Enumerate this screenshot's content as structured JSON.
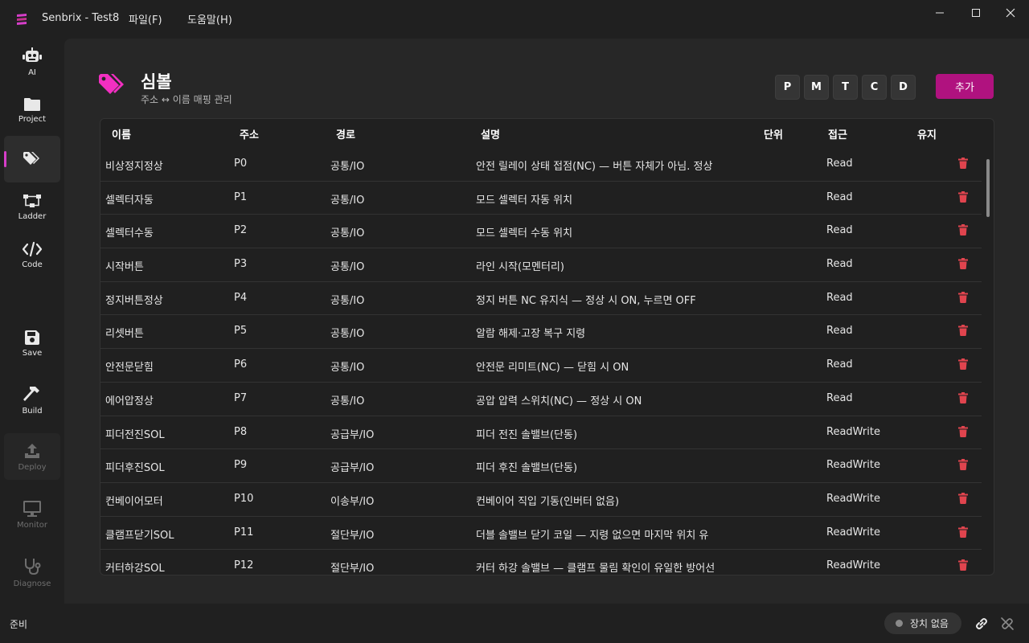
{
  "window": {
    "title": "Senbrix - Test8",
    "menu": [
      "파일(F)",
      "도움말(H)"
    ]
  },
  "nav": [
    {
      "label": "AI",
      "icon": "robot-icon"
    },
    {
      "label": "Project",
      "icon": "folder-icon"
    },
    {
      "label": "",
      "icon": "tags-icon",
      "active": true
    },
    {
      "label": "Ladder",
      "icon": "ladder-icon"
    },
    {
      "label": "Code",
      "icon": "code-icon"
    },
    {
      "label": "Save",
      "icon": "save-icon"
    },
    {
      "label": "Build",
      "icon": "hammer-icon"
    },
    {
      "label": "Deploy",
      "icon": "upload-icon",
      "disabled": true
    },
    {
      "label": "Monitor",
      "icon": "monitor-icon",
      "disabled": true
    },
    {
      "label": "Diagnose",
      "icon": "stethoscope-icon",
      "disabled": true
    }
  ],
  "page": {
    "title": "심볼",
    "subtitle": "주소 ↔ 이름 매핑 관리",
    "filters": [
      "P",
      "M",
      "T",
      "C",
      "D"
    ],
    "add_label": "추가"
  },
  "table": {
    "columns": {
      "name": "이름",
      "addr": "주소",
      "path": "경로",
      "desc": "설명",
      "unit": "단위",
      "access": "접근",
      "retain": "유지"
    },
    "rows": [
      {
        "name": "비상정지정상",
        "addr": "P0",
        "path": "공통/IO",
        "desc": "안전 릴레이 상태 접점(NC) — 버튼 자체가 아님. 정상",
        "access": "Read"
      },
      {
        "name": "셀렉터자동",
        "addr": "P1",
        "path": "공통/IO",
        "desc": "모드 셀렉터 자동 위치",
        "access": "Read"
      },
      {
        "name": "셀렉터수동",
        "addr": "P2",
        "path": "공통/IO",
        "desc": "모드 셀렉터 수동 위치",
        "access": "Read"
      },
      {
        "name": "시작버튼",
        "addr": "P3",
        "path": "공통/IO",
        "desc": "라인 시작(모멘터리)",
        "access": "Read"
      },
      {
        "name": "정지버튼정상",
        "addr": "P4",
        "path": "공통/IO",
        "desc": "정지 버튼 NC 유지식 — 정상 시 ON, 누르면 OFF",
        "access": "Read"
      },
      {
        "name": "리셋버튼",
        "addr": "P5",
        "path": "공통/IO",
        "desc": "알람 해제·고장 복구 지령",
        "access": "Read"
      },
      {
        "name": "안전문닫힘",
        "addr": "P6",
        "path": "공통/IO",
        "desc": "안전문 리미트(NC) — 닫힘 시 ON",
        "access": "Read"
      },
      {
        "name": "에어압정상",
        "addr": "P7",
        "path": "공통/IO",
        "desc": "공압 압력 스위치(NC) — 정상 시 ON",
        "access": "Read"
      },
      {
        "name": "피더전진SOL",
        "addr": "P8",
        "path": "공급부/IO",
        "desc": "피더 전진 솔밸브(단동)",
        "access": "ReadWrite"
      },
      {
        "name": "피더후진SOL",
        "addr": "P9",
        "path": "공급부/IO",
        "desc": "피더 후진 솔밸브(단동)",
        "access": "ReadWrite"
      },
      {
        "name": "컨베이어모터",
        "addr": "P10",
        "path": "이송부/IO",
        "desc": "컨베이어 직입 기동(인버터 없음)",
        "access": "ReadWrite"
      },
      {
        "name": "클램프닫기SOL",
        "addr": "P11",
        "path": "절단부/IO",
        "desc": "더블 솔밸브 닫기 코일 — 지령 없으면 마지막 위치 유",
        "access": "ReadWrite"
      },
      {
        "name": "커터하강SOL",
        "addr": "P12",
        "path": "절단부/IO",
        "desc": "커터 하강 솔밸브 — 클램프 물림 확인이 유일한 방어선",
        "access": "ReadWrite"
      }
    ]
  },
  "status": {
    "text": "준비",
    "device": "장치 없음"
  },
  "colors": {
    "accent": "#d63ec9",
    "add_button": "#b0127f",
    "delete_icon": "#e0444e"
  }
}
